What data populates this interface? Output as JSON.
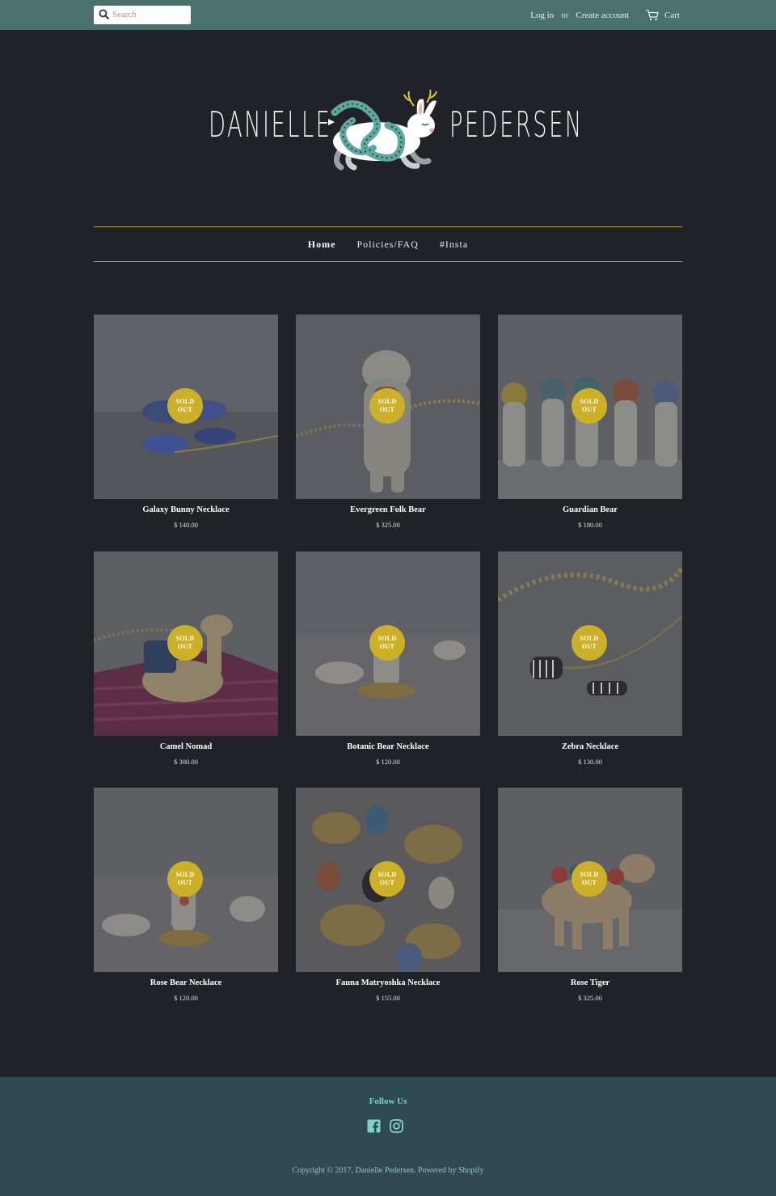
{
  "topbar": {
    "search_placeholder": "Search",
    "login": "Log in",
    "or": "or",
    "create_account": "Create account",
    "cart": "Cart"
  },
  "logo": {
    "left": "DANIELLE",
    "right": "PEDERSEN"
  },
  "nav": [
    "Home",
    "Policies/FAQ",
    "#Insta"
  ],
  "badge": {
    "line1": "SOLD",
    "line2": "OUT"
  },
  "products": [
    {
      "title": "Galaxy Bunny Necklace",
      "price": "$ 140.00"
    },
    {
      "title": "Evergreen Folk Bear",
      "price": "$ 325.00"
    },
    {
      "title": "Guardian Bear",
      "price": "$ 180.00"
    },
    {
      "title": "Camel Nomad",
      "price": "$ 300.00"
    },
    {
      "title": "Botanic Bear Necklace",
      "price": "$ 120.00"
    },
    {
      "title": "Zebra Necklace",
      "price": "$ 130.00"
    },
    {
      "title": "Rose Bear Necklace",
      "price": "$ 120.00"
    },
    {
      "title": "Fauna Matryoshka Necklace",
      "price": "$ 155.00"
    },
    {
      "title": "Rose Tiger",
      "price": "$ 325.00"
    }
  ],
  "footer": {
    "follow": "Follow Us",
    "copyright": "Copyright © 2017, Danielle Pedersen. Powered by Shopify"
  },
  "colors": {
    "topbar": "#4b716b",
    "page_bg": "#212228",
    "nav_rule": "#b9a24a",
    "badge": "#cdb02a",
    "footer_bg": "#304a52",
    "footer_text": "#7dd3bf"
  }
}
